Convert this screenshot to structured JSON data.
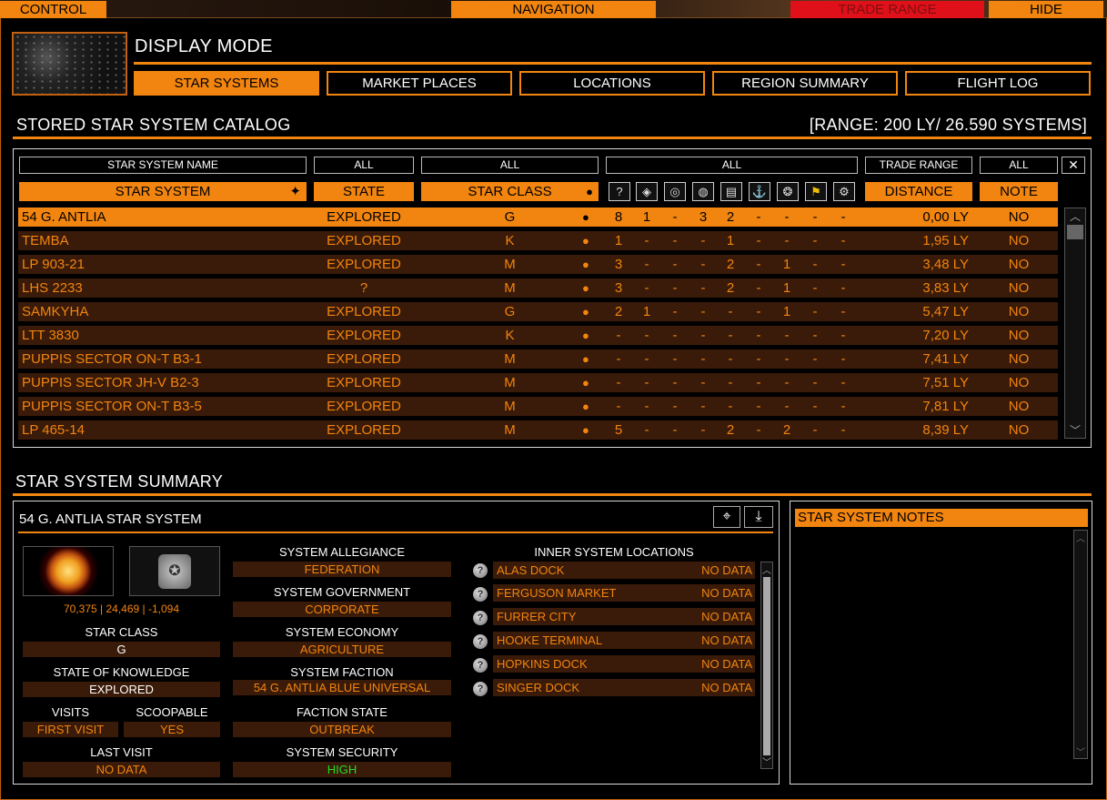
{
  "topbar": {
    "control": "CONTROL",
    "navigation": "NAVIGATION",
    "trade_range": "TRADE RANGE",
    "hide": "HIDE"
  },
  "display_mode": {
    "title": "DISPLAY MODE",
    "tabs": [
      "STAR SYSTEMS",
      "MARKET PLACES",
      "LOCATIONS",
      "REGION SUMMARY",
      "FLIGHT LOG"
    ]
  },
  "catalog": {
    "title": "STORED STAR SYSTEM CATALOG",
    "range": "[RANGE: 200 LY/ 26.590 SYSTEMS]",
    "filters": {
      "name": "STAR SYSTEM NAME",
      "state": "ALL",
      "class": "ALL",
      "icons": "ALL",
      "trade": "TRADE RANGE",
      "note": "ALL"
    },
    "columns": {
      "system": "STAR SYSTEM",
      "state": "STATE",
      "class": "STAR CLASS",
      "distance": "DISTANCE",
      "note": "NOTE"
    },
    "rows": [
      {
        "name": "54 G. ANTLIA",
        "state": "EXPLORED",
        "cls": "G",
        "c": [
          "8",
          "1",
          "-",
          "3",
          "2",
          "-",
          "-",
          "-",
          "-"
        ],
        "dist": "0,00 LY",
        "note": "NO"
      },
      {
        "name": "TEMBA",
        "state": "EXPLORED",
        "cls": "K",
        "c": [
          "1",
          "-",
          "-",
          "-",
          "1",
          "-",
          "-",
          "-",
          "-"
        ],
        "dist": "1,95 LY",
        "note": "NO"
      },
      {
        "name": "LP 903-21",
        "state": "EXPLORED",
        "cls": "M",
        "c": [
          "3",
          "-",
          "-",
          "-",
          "2",
          "-",
          "1",
          "-",
          "-"
        ],
        "dist": "3,48 LY",
        "note": "NO"
      },
      {
        "name": "LHS 2233",
        "state": "?",
        "cls": "M",
        "c": [
          "3",
          "-",
          "-",
          "-",
          "2",
          "-",
          "1",
          "-",
          "-"
        ],
        "dist": "3,83 LY",
        "note": "NO"
      },
      {
        "name": "SAMKYHA",
        "state": "EXPLORED",
        "cls": "G",
        "c": [
          "2",
          "1",
          "-",
          "-",
          "-",
          "-",
          "1",
          "-",
          "-"
        ],
        "dist": "5,47 LY",
        "note": "NO"
      },
      {
        "name": "LTT 3830",
        "state": "EXPLORED",
        "cls": "K",
        "c": [
          "-",
          "-",
          "-",
          "-",
          "-",
          "-",
          "-",
          "-",
          "-"
        ],
        "dist": "7,20 LY",
        "note": "NO"
      },
      {
        "name": "PUPPIS SECTOR ON-T B3-1",
        "state": "EXPLORED",
        "cls": "M",
        "c": [
          "-",
          "-",
          "-",
          "-",
          "-",
          "-",
          "-",
          "-",
          "-"
        ],
        "dist": "7,41 LY",
        "note": "NO"
      },
      {
        "name": "PUPPIS SECTOR JH-V B2-3",
        "state": "EXPLORED",
        "cls": "M",
        "c": [
          "-",
          "-",
          "-",
          "-",
          "-",
          "-",
          "-",
          "-",
          "-"
        ],
        "dist": "7,51 LY",
        "note": "NO"
      },
      {
        "name": "PUPPIS SECTOR ON-T B3-5",
        "state": "EXPLORED",
        "cls": "M",
        "c": [
          "-",
          "-",
          "-",
          "-",
          "-",
          "-",
          "-",
          "-",
          "-"
        ],
        "dist": "7,81 LY",
        "note": "NO"
      },
      {
        "name": "LP 465-14",
        "state": "EXPLORED",
        "cls": "M",
        "c": [
          "5",
          "-",
          "-",
          "-",
          "2",
          "-",
          "2",
          "-",
          "-"
        ],
        "dist": "8,39 LY",
        "note": "NO"
      }
    ]
  },
  "summary": {
    "title": "STAR SYSTEM SUMMARY",
    "system_title": "54 G. ANTLIA STAR SYSTEM",
    "coords": "70,375 | 24,469 | -1,094",
    "star_class_label": "STAR CLASS",
    "star_class": "G",
    "knowledge_label": "STATE OF KNOWLEDGE",
    "knowledge": "EXPLORED",
    "visits_label": "VISITS",
    "visits": "FIRST VISIT",
    "scoopable_label": "SCOOPABLE",
    "scoopable": "YES",
    "last_visit_label": "LAST VISIT",
    "last_visit": "NO DATA",
    "allegiance_label": "SYSTEM ALLEGIANCE",
    "allegiance": "FEDERATION",
    "government_label": "SYSTEM GOVERNMENT",
    "government": "CORPORATE",
    "economy_label": "SYSTEM ECONOMY",
    "economy": "AGRICULTURE",
    "faction_label": "SYSTEM FACTION",
    "faction": "54 G. ANTLIA BLUE UNIVERSAL",
    "faction_state_label": "FACTION STATE",
    "faction_state": "OUTBREAK",
    "security_label": "SYSTEM SECURITY",
    "security": "HIGH",
    "security_color": "#22dd22",
    "locations_label": "INNER SYSTEM LOCATIONS",
    "locations": [
      {
        "name": "ALAS DOCK",
        "status": "NO DATA"
      },
      {
        "name": "FERGUSON MARKET",
        "status": "NO DATA"
      },
      {
        "name": "FURRER CITY",
        "status": "NO DATA"
      },
      {
        "name": "HOOKE TERMINAL",
        "status": "NO DATA"
      },
      {
        "name": "HOPKINS DOCK",
        "status": "NO DATA"
      },
      {
        "name": "SINGER DOCK",
        "status": "NO DATA"
      }
    ]
  },
  "notes": {
    "title": "STAR SYSTEM NOTES"
  },
  "colors": {
    "accent": "#f2850f",
    "row_bg": "#3a1a08",
    "alert": "#e0101a"
  }
}
